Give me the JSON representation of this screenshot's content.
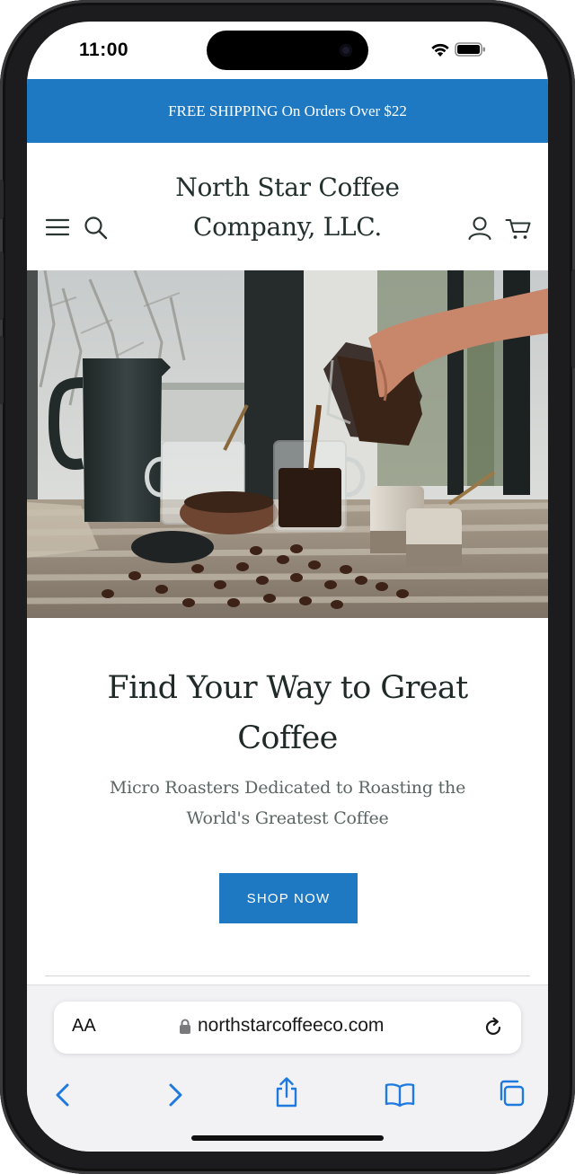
{
  "status_bar": {
    "time": "11:00"
  },
  "promo_banner": {
    "text": "FREE SHIPPING On Orders Over $22"
  },
  "header": {
    "logo_line1": "North Star Coffee",
    "logo_line2": "Company, LLC.",
    "icons": [
      "menu-icon",
      "search-icon",
      "account-icon",
      "cart-icon"
    ]
  },
  "hero": {
    "headline_line1": "Find Your Way to Great",
    "headline_line2": "Coffee",
    "subhead_line1": "Micro Roasters Dedicated to Roasting the",
    "subhead_line2": "World's Greatest Coffee",
    "cta_label": "SHOP NOW"
  },
  "browser": {
    "text_size_label": "AA",
    "url": "northstarcoffeeco.com",
    "toolbar": [
      "back-icon",
      "forward-icon",
      "share-icon",
      "bookmarks-icon",
      "tabs-icon"
    ]
  },
  "colors": {
    "brand_blue": "#1f79c2",
    "ios_blue": "#1f7ae0",
    "text_dark": "#202b29"
  }
}
